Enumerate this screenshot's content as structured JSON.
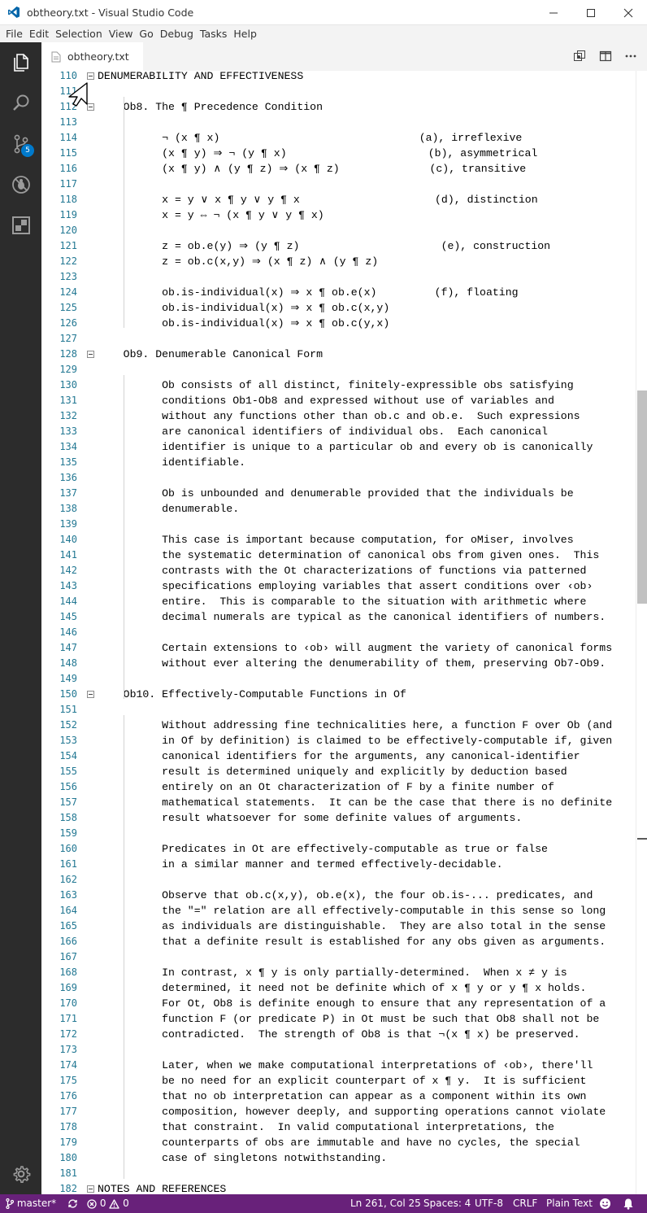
{
  "window": {
    "title": "obtheory.txt - Visual Studio Code",
    "controls": {
      "minimize": "minimize-icon",
      "maximize": "maximize-icon",
      "close": "close-icon"
    }
  },
  "menu": [
    "File",
    "Edit",
    "Selection",
    "View",
    "Go",
    "Debug",
    "Tasks",
    "Help"
  ],
  "activity_bar": {
    "items": [
      "explorer-icon",
      "search-icon",
      "source-control-icon",
      "debug-icon",
      "extensions-icon"
    ],
    "source_control_badge": "5",
    "settings": "gear-icon"
  },
  "tabs": [
    {
      "label": "obtheory.txt",
      "active": true
    }
  ],
  "editor_actions": [
    "open-changes-icon",
    "split-editor-icon",
    "more-actions-icon"
  ],
  "editor": {
    "lines": [
      {
        "n": "110",
        "text": "DENUMERABILITY AND EFFECTIVENESS",
        "fold": true
      },
      {
        "n": "111",
        "text": "",
        "fold": false
      },
      {
        "n": "112",
        "text": "    Ob8. The ¶ Precedence Condition",
        "fold": true
      },
      {
        "n": "113",
        "text": "",
        "fold": false
      },
      {
        "n": "114",
        "text": "          ¬ (x ¶ x)                               (a), irreflexive",
        "fold": false
      },
      {
        "n": "115",
        "text": "          (x ¶ y) ⇒ ¬ (y ¶ x)                      (b), asymmetrical",
        "fold": false
      },
      {
        "n": "116",
        "text": "          (x ¶ y) ∧ (y ¶ z) ⇒ (x ¶ z)              (c), transitive",
        "fold": false
      },
      {
        "n": "117",
        "text": "",
        "fold": false
      },
      {
        "n": "118",
        "text": "          x = y ∨ x ¶ y ∨ y ¶ x                     (d), distinction",
        "fold": false
      },
      {
        "n": "119",
        "text": "          x = y ⇔ ¬ (x ¶ y ∨ y ¶ x)",
        "fold": false
      },
      {
        "n": "120",
        "text": "",
        "fold": false
      },
      {
        "n": "121",
        "text": "          z = ob.e(y) ⇒ (y ¶ z)                      (e), construction",
        "fold": false
      },
      {
        "n": "122",
        "text": "          z = ob.c(x,y) ⇒ (x ¶ z) ∧ (y ¶ z)",
        "fold": false
      },
      {
        "n": "123",
        "text": "",
        "fold": false
      },
      {
        "n": "124",
        "text": "          ob.is-individual(x) ⇒ x ¶ ob.e(x)         (f), floating",
        "fold": false
      },
      {
        "n": "125",
        "text": "          ob.is-individual(x) ⇒ x ¶ ob.c(x,y)",
        "fold": false
      },
      {
        "n": "126",
        "text": "          ob.is-individual(x) ⇒ x ¶ ob.c(y,x)",
        "fold": false
      },
      {
        "n": "127",
        "text": "",
        "fold": false
      },
      {
        "n": "128",
        "text": "    Ob9. Denumerable Canonical Form",
        "fold": true
      },
      {
        "n": "129",
        "text": "",
        "fold": false
      },
      {
        "n": "130",
        "text": "          Ob consists of all distinct, finitely-expressible obs satisfying",
        "fold": false
      },
      {
        "n": "131",
        "text": "          conditions Ob1-Ob8 and expressed without use of variables and",
        "fold": false
      },
      {
        "n": "132",
        "text": "          without any functions other than ob.c and ob.e.  Such expressions",
        "fold": false
      },
      {
        "n": "133",
        "text": "          are canonical identifiers of individual obs.  Each canonical",
        "fold": false
      },
      {
        "n": "134",
        "text": "          identifier is unique to a particular ob and every ob is canonically",
        "fold": false
      },
      {
        "n": "135",
        "text": "          identifiable.",
        "fold": false
      },
      {
        "n": "136",
        "text": "",
        "fold": false
      },
      {
        "n": "137",
        "text": "          Ob is unbounded and denumerable provided that the individuals be",
        "fold": false
      },
      {
        "n": "138",
        "text": "          denumerable.",
        "fold": false
      },
      {
        "n": "139",
        "text": "",
        "fold": false
      },
      {
        "n": "140",
        "text": "          This case is important because computation, for oMiser, involves",
        "fold": false
      },
      {
        "n": "141",
        "text": "          the systematic determination of canonical obs from given ones.  This",
        "fold": false
      },
      {
        "n": "142",
        "text": "          contrasts with the Ot characterizations of functions via patterned",
        "fold": false
      },
      {
        "n": "143",
        "text": "          specifications employing variables that assert conditions over ‹ob›",
        "fold": false
      },
      {
        "n": "144",
        "text": "          entire.  This is comparable to the situation with arithmetic where",
        "fold": false
      },
      {
        "n": "145",
        "text": "          decimal numerals are typical as the canonical identifiers of numbers.",
        "fold": false
      },
      {
        "n": "146",
        "text": "",
        "fold": false
      },
      {
        "n": "147",
        "text": "          Certain extensions to ‹ob› will augment the variety of canonical forms",
        "fold": false
      },
      {
        "n": "148",
        "text": "          without ever altering the denumerability of them, preserving Ob7-Ob9.",
        "fold": false
      },
      {
        "n": "149",
        "text": "",
        "fold": false
      },
      {
        "n": "150",
        "text": "    Ob10. Effectively-Computable Functions in Of",
        "fold": true
      },
      {
        "n": "151",
        "text": "",
        "fold": false
      },
      {
        "n": "152",
        "text": "          Without addressing fine technicalities here, a function F over Ob (and",
        "fold": false
      },
      {
        "n": "153",
        "text": "          in Of by definition) is claimed to be effectively-computable if, given",
        "fold": false
      },
      {
        "n": "154",
        "text": "          canonical identifiers for the arguments, any canonical-identifier",
        "fold": false
      },
      {
        "n": "155",
        "text": "          result is determined uniquely and explicitly by deduction based",
        "fold": false
      },
      {
        "n": "156",
        "text": "          entirely on an Ot characterization of F by a finite number of",
        "fold": false
      },
      {
        "n": "157",
        "text": "          mathematical statements.  It can be the case that there is no definite",
        "fold": false
      },
      {
        "n": "158",
        "text": "          result whatsoever for some definite values of arguments.",
        "fold": false
      },
      {
        "n": "159",
        "text": "",
        "fold": false
      },
      {
        "n": "160",
        "text": "          Predicates in Ot are effectively-computable as true or false",
        "fold": false
      },
      {
        "n": "161",
        "text": "          in a similar manner and termed effectively-decidable.",
        "fold": false
      },
      {
        "n": "162",
        "text": "",
        "fold": false
      },
      {
        "n": "163",
        "text": "          Observe that ob.c(x,y), ob.e(x), the four ob.is-... predicates, and",
        "fold": false
      },
      {
        "n": "164",
        "text": "          the \"=\" relation are all effectively-computable in this sense so long",
        "fold": false
      },
      {
        "n": "165",
        "text": "          as individuals are distinguishable.  They are also total in the sense",
        "fold": false
      },
      {
        "n": "166",
        "text": "          that a definite result is established for any obs given as arguments.",
        "fold": false
      },
      {
        "n": "167",
        "text": "",
        "fold": false
      },
      {
        "n": "168",
        "text": "          In contrast, x ¶ y is only partially-determined.  When x ≠ y is",
        "fold": false
      },
      {
        "n": "169",
        "text": "          determined, it need not be definite which of x ¶ y or y ¶ x holds.",
        "fold": false
      },
      {
        "n": "170",
        "text": "          For Ot, Ob8 is definite enough to ensure that any representation of a",
        "fold": false
      },
      {
        "n": "171",
        "text": "          function F (or predicate P) in Ot must be such that Ob8 shall not be",
        "fold": false
      },
      {
        "n": "172",
        "text": "          contradicted.  The strength of Ob8 is that ¬(x ¶ x) be preserved.",
        "fold": false
      },
      {
        "n": "173",
        "text": "",
        "fold": false
      },
      {
        "n": "174",
        "text": "          Later, when we make computational interpretations of ‹ob›, there'll",
        "fold": false
      },
      {
        "n": "175",
        "text": "          be no need for an explicit counterpart of x ¶ y.  It is sufficient",
        "fold": false
      },
      {
        "n": "176",
        "text": "          that no ob interpretation can appear as a component within its own",
        "fold": false
      },
      {
        "n": "177",
        "text": "          composition, however deeply, and supporting operations cannot violate",
        "fold": false
      },
      {
        "n": "178",
        "text": "          that constraint.  In valid computational interpretations, the",
        "fold": false
      },
      {
        "n": "179",
        "text": "          counterparts of obs are immutable and have no cycles, the special",
        "fold": false
      },
      {
        "n": "180",
        "text": "          case of singletons notwithstanding.",
        "fold": false
      },
      {
        "n": "181",
        "text": "",
        "fold": false
      },
      {
        "n": "182",
        "text": "NOTES AND REFERENCES",
        "fold": true
      }
    ]
  },
  "status_bar": {
    "branch": "master*",
    "sync": "sync-icon",
    "errors": "0",
    "warnings": "0",
    "position": "Ln 261, Col 25",
    "spaces": "Spaces: 4",
    "encoding": "UTF-8",
    "eol": "CRLF",
    "language": "Plain Text",
    "feedback": "smiley-icon",
    "notifications": "bell-icon"
  },
  "colors": {
    "status_bar": "#68217a",
    "activity_bar": "#2c2c2c",
    "line_numbers": "#237893",
    "accent": "#007acc"
  }
}
